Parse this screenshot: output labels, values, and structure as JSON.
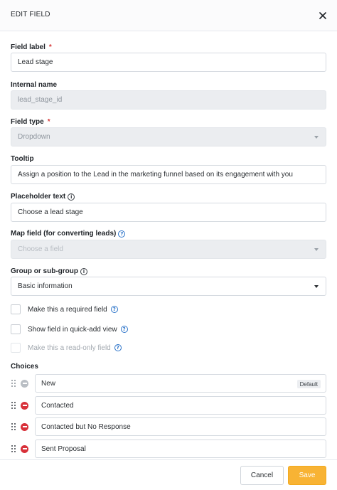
{
  "header": {
    "title": "EDIT FIELD",
    "close_icon": "close-icon"
  },
  "field_label": {
    "label": "Field label",
    "required_mark": "*",
    "value": "Lead stage"
  },
  "internal_name": {
    "label": "Internal name",
    "value": "lead_stage_id"
  },
  "field_type": {
    "label": "Field type",
    "required_mark": "*",
    "value": "Dropdown"
  },
  "tooltip": {
    "label": "Tooltip",
    "value": "Assign a position to the Lead in the marketing funnel based on its engagement with you"
  },
  "placeholder_text": {
    "label": "Placeholder text",
    "value": "Choose a lead stage"
  },
  "map_field": {
    "label": "Map field (for converting leads)",
    "value": "Choose a field"
  },
  "group": {
    "label": "Group or sub-group",
    "value": "Basic information"
  },
  "options": {
    "required": {
      "label": "Make this a required field",
      "checked": false
    },
    "quick_add": {
      "label": "Show field in quick-add view",
      "checked": false
    },
    "read_only": {
      "label": "Make this a read-only field",
      "checked": false,
      "disabled": true
    }
  },
  "choices": {
    "label": "Choices",
    "items": [
      {
        "name": "New",
        "badge": "Default"
      },
      {
        "name": "Contacted"
      },
      {
        "name": "Contacted but No Response"
      },
      {
        "name": "Sent Proposal"
      }
    ]
  },
  "footer": {
    "cancel_label": "Cancel",
    "save_label": "Save"
  },
  "colors": {
    "accent": "#f8b334",
    "required": "#d63a3a",
    "remove": "#d8313a",
    "info_blue": "#2b73c9"
  }
}
